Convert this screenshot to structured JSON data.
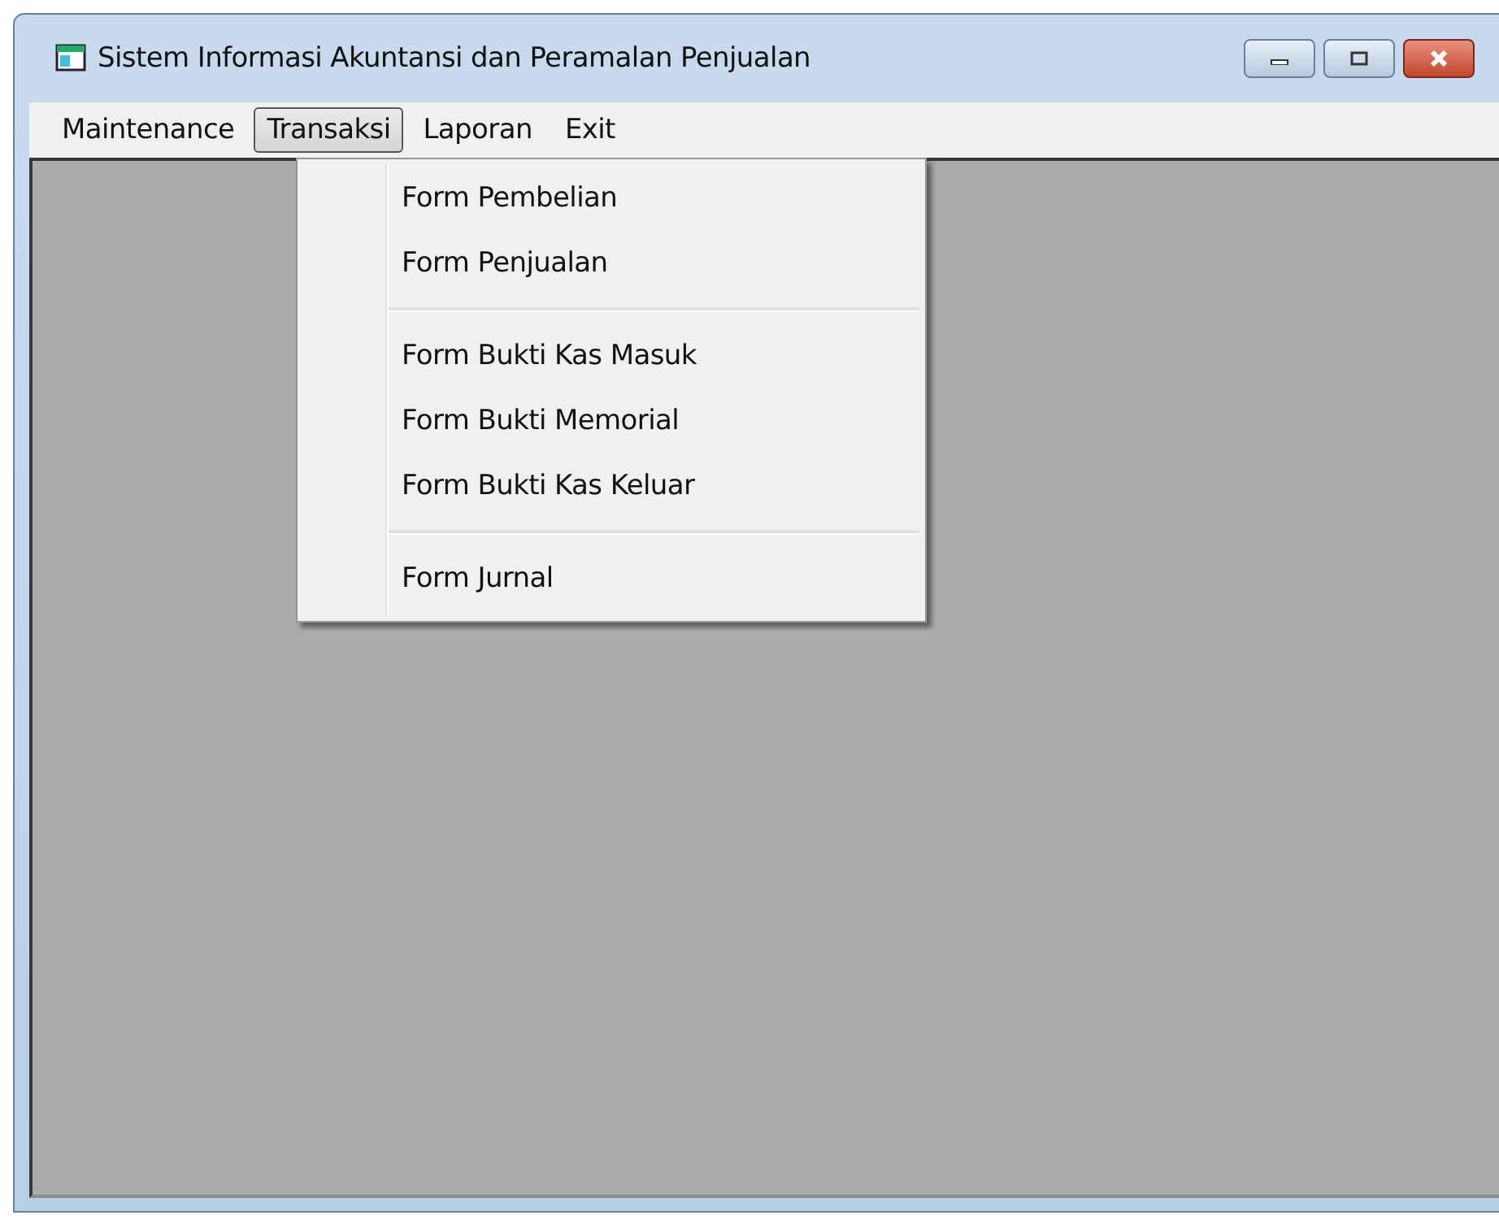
{
  "window": {
    "title": "Sistem Informasi Akuntansi dan Peramalan Penjualan"
  },
  "menu_bar": [
    {
      "label": "Maintenance",
      "selected": false
    },
    {
      "label": "Transaksi",
      "selected": true
    },
    {
      "label": "Laporan",
      "selected": false
    },
    {
      "label": "Exit",
      "selected": false
    }
  ],
  "dropdown": [
    {
      "kind": "item",
      "label": "Form Pembelian"
    },
    {
      "kind": "item",
      "label": "Form Penjualan"
    },
    {
      "kind": "separator"
    },
    {
      "kind": "item",
      "label": "Form Bukti Kas Masuk"
    },
    {
      "kind": "item",
      "label": "Form Bukti Memorial"
    },
    {
      "kind": "item",
      "label": "Form Bukti Kas Keluar"
    },
    {
      "kind": "separator"
    },
    {
      "kind": "item",
      "label": "Form Jurnal"
    }
  ]
}
